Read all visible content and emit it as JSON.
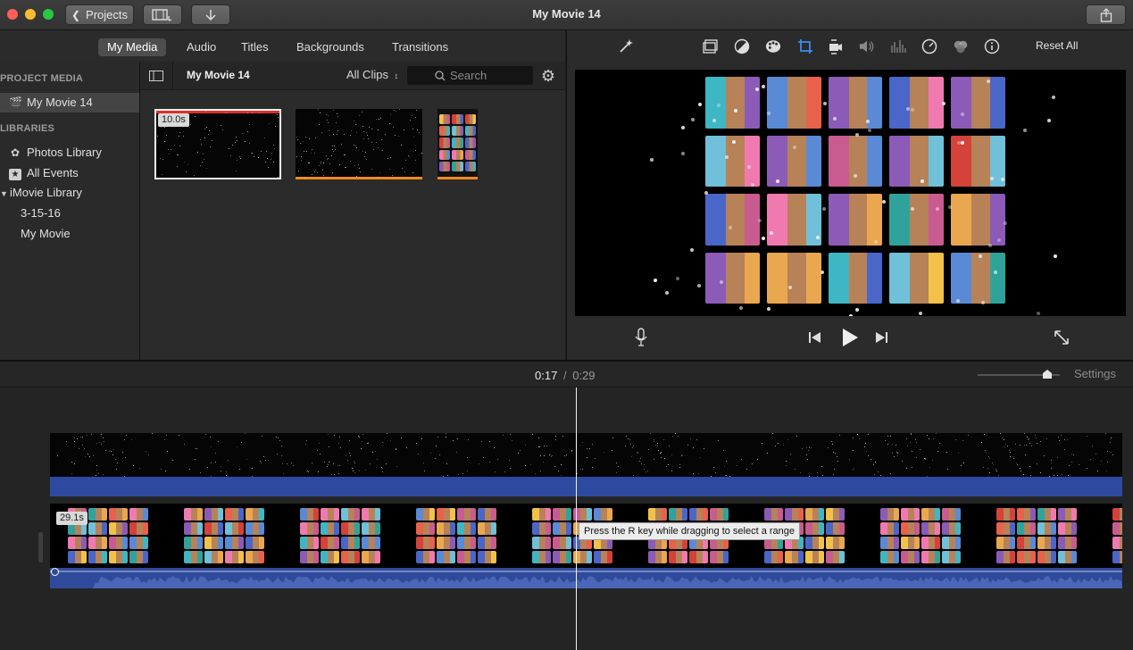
{
  "window": {
    "title": "My Movie 14",
    "projects_button": "Projects"
  },
  "media_tabs": [
    {
      "label": "My Media",
      "active": true
    },
    {
      "label": "Audio",
      "active": false
    },
    {
      "label": "Titles",
      "active": false
    },
    {
      "label": "Backgrounds",
      "active": false
    },
    {
      "label": "Transitions",
      "active": false
    }
  ],
  "sidebar": {
    "project_media_heading": "PROJECT MEDIA",
    "project_item": "My Movie 14",
    "libraries_heading": "LIBRARIES",
    "items": [
      {
        "label": "Photos Library",
        "icon": "photos-icon"
      },
      {
        "label": "All Events",
        "icon": "star-icon"
      },
      {
        "label": "iMovie Library",
        "icon": "disclosure-triangle-icon"
      },
      {
        "label": "3-15-16",
        "icon": ""
      },
      {
        "label": "My Movie",
        "icon": ""
      }
    ]
  },
  "browser": {
    "project_name": "My Movie 14",
    "filter_label": "All Clips",
    "search_placeholder": "Search",
    "clips": [
      {
        "duration_badge": "10.0s",
        "selected": true,
        "kind": "starfield"
      },
      {
        "duration_badge": "",
        "selected": false,
        "kind": "starfield"
      },
      {
        "duration_badge": "",
        "selected": false,
        "kind": "artwork"
      }
    ]
  },
  "viewer_toolbar": {
    "reset_all_label": "Reset All",
    "icons": [
      "magic-wand-icon",
      "crop-frame-icon",
      "color-balance-icon",
      "color-palette-icon",
      "crop-icon",
      "stabilization-camera-icon",
      "volume-icon",
      "equalizer-icon",
      "speed-gauge-icon",
      "clip-filter-icon",
      "info-icon"
    ]
  },
  "playback": {
    "current_time": "0:17",
    "separator": "/",
    "total_time": "0:29"
  },
  "timeline": {
    "settings_label": "Settings",
    "clip_duration_badge": "29.1s",
    "tooltip": "Press the R key while dragging to select a range",
    "zoom_level": 0.85
  },
  "colors": {
    "accent_blue": "#2d4aa0",
    "audio_blue": "#2f4a9a",
    "selection_red": "#e0302a",
    "orange_bar": "#f08a1c"
  }
}
